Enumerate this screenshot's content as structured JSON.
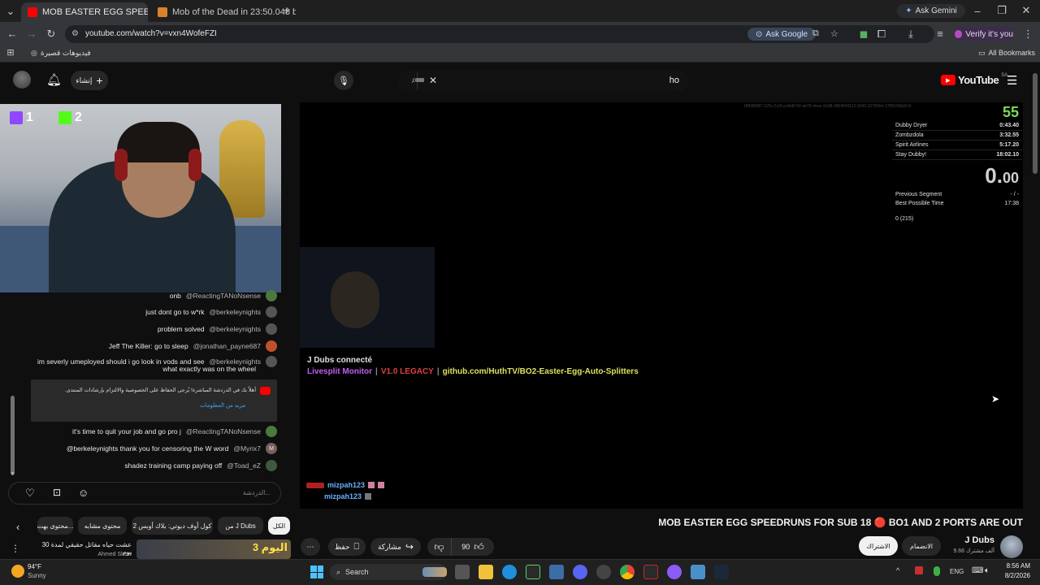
{
  "browser": {
    "tabs": [
      {
        "label": "MOB EASTER EGG SPEEDRUN",
        "active": true
      },
      {
        "label": "Mob of the Dead in 23:50.048 b",
        "active": false
      }
    ],
    "new_tab": "+",
    "ask_gemini": "Ask Gemini",
    "url": "youtube.com/watch?v=vxn4WofeFZI",
    "ask_google": "Ask Google",
    "verify": "Verify it's you",
    "bookmark_shorts": "فيديوهات قصيرة",
    "all_bookmarks": "All Bookmarks"
  },
  "yt_header": {
    "create_label": "إنشاء",
    "search_value": "ho",
    "logo_text": "YouTube",
    "region": "SA"
  },
  "webcam": {
    "twitch_count": "1",
    "kick_count": "2"
  },
  "chat": {
    "messages": [
      {
        "text": "onb",
        "author": "@ReactingTANoNsense",
        "color": "#4a7a3e"
      },
      {
        "text": "just dont go to w*rk",
        "author": "@berkeleynights",
        "color": "#555"
      },
      {
        "text": "problem solved",
        "author": "@berkeleynights",
        "color": "#555"
      },
      {
        "text": "Jeff The Killer: go to sleep",
        "author": "@jonathan_payne687",
        "color": "#c0502a"
      },
      {
        "text": "im severly umeployed should i go look in vods and see",
        "author": "@berkeleynights",
        "color": "#555"
      },
      {
        "text": "what exactly was on the wheel",
        "author": "",
        "color": ""
      },
      {
        "text": "it's time to quit your job and go pro j",
        "author": "@ReactingTANoNsense",
        "color": "#4a7a3e"
      },
      {
        "text": "@berkeleynights thank you for censoring the W word",
        "author": "@Myrix7",
        "color": "#7a5f5f"
      },
      {
        "text": "shadez training camp paying off",
        "author": "@Toad_eZ",
        "color": "#3e5a3e"
      }
    ],
    "notice_text": "أهلاً بك في الدردشة المباشرة! يُرجى الحفاظ على الخصوصية والالتزام بإرشادات المنتدى.",
    "notice_link": "مزيد من المعلومات",
    "myrix_initial": "M",
    "input_placeholder": "الدردشة..."
  },
  "video": {
    "splits_title_num": "55",
    "splits_header": "1f8585887-325c-2c2f-ce6b8742-ab78-4eee-92d8-2864549112-9340-2278454-1785505b00-8",
    "splits": [
      {
        "name": "Dubby Dryer",
        "time": "0:43.40"
      },
      {
        "name": "Zombzdola",
        "time": "3:32.55"
      },
      {
        "name": "Spirit Airlines",
        "time": "5:17.20"
      },
      {
        "name": "Stay Dubby!",
        "time": "18:02.10"
      }
    ],
    "timer_main": "0.",
    "timer_frac": "00",
    "prev_segment_label": "Previous Segment",
    "prev_segment_value": "- / -",
    "best_time_label": "Best Possible Time",
    "best_time_value": "17:38",
    "attempts": "0 (215)",
    "connected_text": "J Dubs connecté",
    "livesplit_label": "Livesplit Monitor",
    "livesplit_ver": "V1.0 LEGACY",
    "livesplit_url": "github.com/HuthTV/BO2-Easter-Egg-Auto-Splitters",
    "bottom_user1": "mizpah123",
    "bottom_user2": "mizpah123"
  },
  "below": {
    "chips": [
      "الكل",
      "من J Dubs",
      "كول أوف ديوتي: بلاك أوبس 2",
      "محتوى مشابه",
      "محتوى بهت..."
    ],
    "title": "MOB EASTER EGG SPEEDRUNS FOR SUB 18 🔴 BO1 AND 2 PORTS ARE OUT",
    "channel_name": "J Dubs",
    "subs": "9.66 ألف مشترك",
    "join": "الانضمام",
    "subscribe": "الاشتراك",
    "likes": "90",
    "share": "مشاركة",
    "save": "حفظ",
    "rec_title": "عشت حياه مقاتل حقيقي لمدة 30 يوم",
    "rec_channel": "Ahmed Show",
    "rec_thumb_text": "اليوم 3"
  },
  "taskbar": {
    "weather_temp": "94°F",
    "weather_desc": "Sunny",
    "search": "Search",
    "lang": "ENG",
    "time": "8:56 AM",
    "date": "8/2/2026"
  }
}
